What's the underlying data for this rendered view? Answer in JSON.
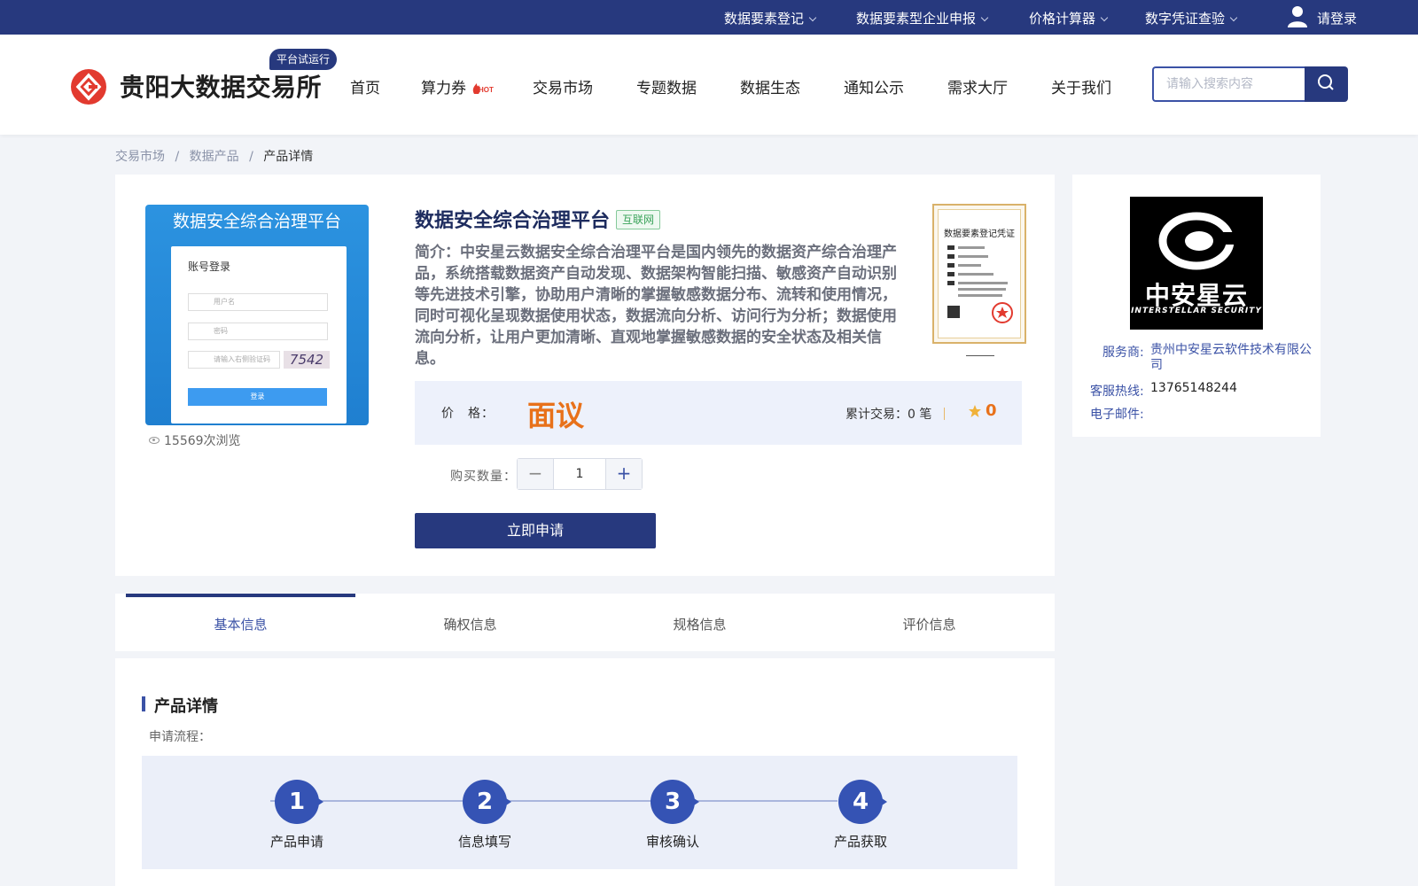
{
  "topbar": {
    "links": [
      "数据要素登记",
      "数据要素型企业申报",
      "价格计算器",
      "数字凭证查验"
    ],
    "login": "请登录"
  },
  "header": {
    "logo_text": "贵阳大数据交易所",
    "trial_badge": "平台试运行",
    "nav": [
      "首页",
      "算力券",
      "交易市场",
      "专题数据",
      "数据生态",
      "通知公示",
      "需求大厅",
      "关于我们"
    ],
    "hot_badge": "HOT",
    "search_placeholder": "请输入搜索内容"
  },
  "breadcrumb": [
    "交易市场",
    "数据产品",
    "产品详情"
  ],
  "breadcrumb_sep": "/",
  "product": {
    "image_title": "数据安全综合治理平台",
    "image_login_title": "账号登录",
    "image_user_placeholder": "用户名",
    "image_pass_placeholder": "密码",
    "image_captcha_placeholder": "请输入右侧验证码",
    "image_captcha": "7542",
    "image_login_btn": "登录",
    "views": "15569次浏览",
    "title": "数据安全综合治理平台",
    "tag": "互联网",
    "intro": "简介：中安星云数据安全综合治理平台是国内领先的数据资产综合治理产品，系统搭载数据资产自动发现、数据架构智能扫描、敏感资产自动识别等先进技术引擎，协助用户清晰的掌握敏感数据分布、流转和使用情况，同时可视化呈现数据使用状态，数据流向分析、访问行为分析；数据使用流向分析，让用户更加清晰、直观地掌握敏感数据的安全状态及相关信息。",
    "cert_title": "数据要素登记凭证",
    "price_label": "价　格：",
    "price_value": "面议",
    "trade_text": "累计交易：0 笔",
    "rating": "0",
    "qty_label": "购买数量：",
    "qty": "1",
    "minus": "−",
    "plus": "+",
    "apply_btn": "立即申请"
  },
  "vendor": {
    "logo_cn": "中安星云",
    "logo_en": "INTERSTELLAR SECURITY",
    "provider_label": "服务商:",
    "provider": "贵州中安星云软件技术有限公司",
    "hotline_label": "客服热线:",
    "hotline": "13765148244",
    "email_label": "电子邮件:",
    "email": ""
  },
  "tabs": [
    "基本信息",
    "确权信息",
    "规格信息",
    "评价信息"
  ],
  "details": {
    "title": "产品详情",
    "flow_label": "申请流程：",
    "steps": [
      {
        "num": "1",
        "label": "产品申请"
      },
      {
        "num": "2",
        "label": "信息填写"
      },
      {
        "num": "3",
        "label": "审核确认"
      },
      {
        "num": "4",
        "label": "产品获取"
      }
    ]
  },
  "colors": {
    "brand": "#27397e",
    "accent": "#3b52a6",
    "price": "#e8711a",
    "logo_red": "#e23a2f"
  }
}
